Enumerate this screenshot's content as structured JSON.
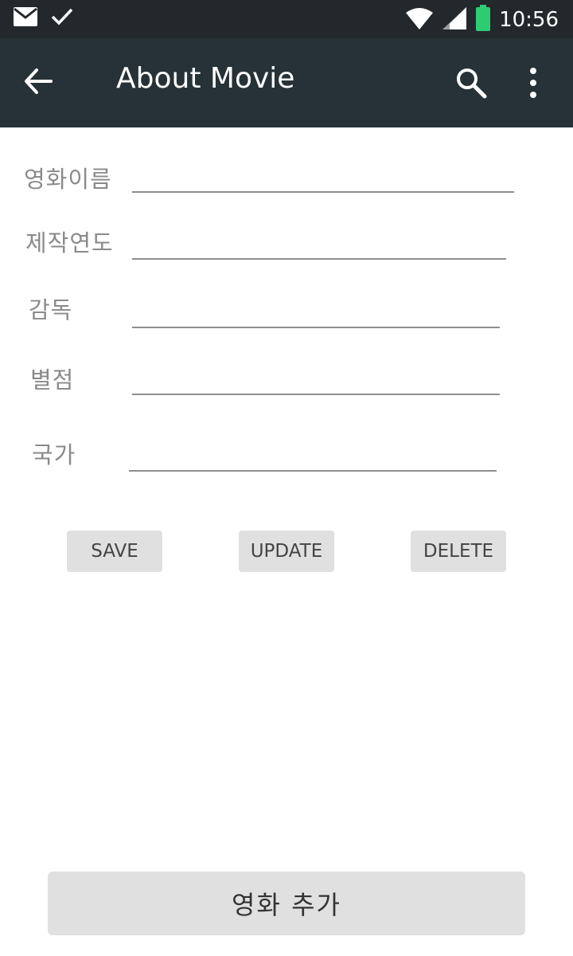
{
  "status_bar": {
    "time": "10:56",
    "icons": [
      "mail-icon",
      "check-icon",
      "wifi-icon",
      "signal-icon",
      "battery-icon"
    ],
    "battery_color": "#2ecc71"
  },
  "app_bar": {
    "title": "About Movie",
    "background": "#263238"
  },
  "form": {
    "fields": [
      {
        "label": "영화이름",
        "value": ""
      },
      {
        "label": "제작연도",
        "value": ""
      },
      {
        "label": "감독",
        "value": ""
      },
      {
        "label": "별점",
        "value": ""
      },
      {
        "label": "국가",
        "value": ""
      }
    ]
  },
  "actions": {
    "save_label": "SAVE",
    "update_label": "UPDATE",
    "delete_label": "DELETE"
  },
  "bottom": {
    "add_label": "영화 추가"
  }
}
